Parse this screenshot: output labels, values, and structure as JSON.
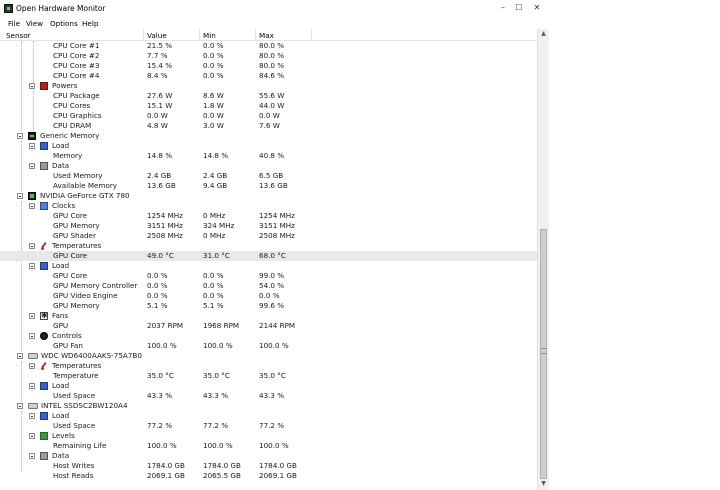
{
  "window": {
    "title": "Open Hardware Monitor",
    "controls": {
      "minimize": "–",
      "maximize": "☐",
      "close": "✕"
    }
  },
  "menu": [
    "File",
    "View",
    "Options",
    "Help"
  ],
  "columns": {
    "sensor": "Sensor",
    "value": "Value",
    "min": "Min",
    "max": "Max"
  },
  "rows": [
    {
      "label": "CPU Core #1",
      "value": "21.5 %",
      "min": "0.0 %",
      "max": "80.0 %"
    },
    {
      "label": "CPU Core #2",
      "value": "7.7 %",
      "min": "0.0 %",
      "max": "80.0 %"
    },
    {
      "label": "CPU Core #3",
      "value": "15.4 %",
      "min": "0.0 %",
      "max": "80.0 %"
    },
    {
      "label": "CPU Core #4",
      "value": "8.4 %",
      "min": "0.0 %",
      "max": "84.6 %"
    },
    {
      "label": "Powers",
      "value": "",
      "min": "",
      "max": ""
    },
    {
      "label": "CPU Package",
      "value": "27.6 W",
      "min": "8.6 W",
      "max": "55.6 W"
    },
    {
      "label": "CPU Cores",
      "value": "15.1 W",
      "min": "1.8 W",
      "max": "44.0 W"
    },
    {
      "label": "CPU Graphics",
      "value": "0.0 W",
      "min": "0.0 W",
      "max": "0.0 W"
    },
    {
      "label": "CPU DRAM",
      "value": "4.8 W",
      "min": "3.0 W",
      "max": "7.6 W"
    },
    {
      "label": "Generic Memory",
      "value": "",
      "min": "",
      "max": ""
    },
    {
      "label": "Load",
      "value": "",
      "min": "",
      "max": ""
    },
    {
      "label": "Memory",
      "value": "14.8 %",
      "min": "14.8 %",
      "max": "40.8 %"
    },
    {
      "label": "Data",
      "value": "",
      "min": "",
      "max": ""
    },
    {
      "label": "Used Memory",
      "value": "2.4 GB",
      "min": "2.4 GB",
      "max": "6.5 GB"
    },
    {
      "label": "Available Memory",
      "value": "13.6 GB",
      "min": "9.4 GB",
      "max": "13.6 GB"
    },
    {
      "label": "NVIDIA GeForce GTX 780",
      "value": "",
      "min": "",
      "max": ""
    },
    {
      "label": "Clocks",
      "value": "",
      "min": "",
      "max": ""
    },
    {
      "label": "GPU Core",
      "value": "1254 MHz",
      "min": "0 MHz",
      "max": "1254 MHz"
    },
    {
      "label": "GPU Memory",
      "value": "3151 MHz",
      "min": "324 MHz",
      "max": "3151 MHz"
    },
    {
      "label": "GPU Shader",
      "value": "2508 MHz",
      "min": "0 MHz",
      "max": "2508 MHz"
    },
    {
      "label": "Temperatures",
      "value": "",
      "min": "",
      "max": ""
    },
    {
      "label": "GPU Core",
      "value": "49.0 °C",
      "min": "31.0 °C",
      "max": "68.0 °C"
    },
    {
      "label": "Load",
      "value": "",
      "min": "",
      "max": ""
    },
    {
      "label": "GPU Core",
      "value": "0.0 %",
      "min": "0.0 %",
      "max": "99.0 %"
    },
    {
      "label": "GPU Memory Controller",
      "value": "0.0 %",
      "min": "0.0 %",
      "max": "54.0 %"
    },
    {
      "label": "GPU Video Engine",
      "value": "0.0 %",
      "min": "0.0 %",
      "max": "0.0 %"
    },
    {
      "label": "GPU Memory",
      "value": "5.1 %",
      "min": "5.1 %",
      "max": "99.6 %"
    },
    {
      "label": "Fans",
      "value": "",
      "min": "",
      "max": ""
    },
    {
      "label": "GPU",
      "value": "2037 RPM",
      "min": "1968 RPM",
      "max": "2144 RPM"
    },
    {
      "label": "Controls",
      "value": "",
      "min": "",
      "max": ""
    },
    {
      "label": "GPU Fan",
      "value": "100.0 %",
      "min": "100.0 %",
      "max": "100.0 %"
    },
    {
      "label": "WDC WD6400AAKS-75A7B0",
      "value": "",
      "min": "",
      "max": ""
    },
    {
      "label": "Temperatures",
      "value": "",
      "min": "",
      "max": ""
    },
    {
      "label": "Temperature",
      "value": "35.0 °C",
      "min": "35.0 °C",
      "max": "35.0 °C"
    },
    {
      "label": "Load",
      "value": "",
      "min": "",
      "max": ""
    },
    {
      "label": "Used Space",
      "value": "43.3 %",
      "min": "43.3 %",
      "max": "43.3 %"
    },
    {
      "label": "INTEL SSDSC2BW120A4",
      "value": "",
      "min": "",
      "max": ""
    },
    {
      "label": "Load",
      "value": "",
      "min": "",
      "max": ""
    },
    {
      "label": "Used Space",
      "value": "77.2 %",
      "min": "77.2 %",
      "max": "77.2 %"
    },
    {
      "label": "Levels",
      "value": "",
      "min": "",
      "max": ""
    },
    {
      "label": "Remaining Life",
      "value": "100.0 %",
      "min": "100.0 %",
      "max": "100.0 %"
    },
    {
      "label": "Data",
      "value": "",
      "min": "",
      "max": ""
    },
    {
      "label": "Host Writes",
      "value": "1784.0 GB",
      "min": "1784.0 GB",
      "max": "1784.0 GB"
    },
    {
      "label": "Host Reads",
      "value": "2069.1 GB",
      "min": "2065.5 GB",
      "max": "2069.1 GB"
    }
  ]
}
